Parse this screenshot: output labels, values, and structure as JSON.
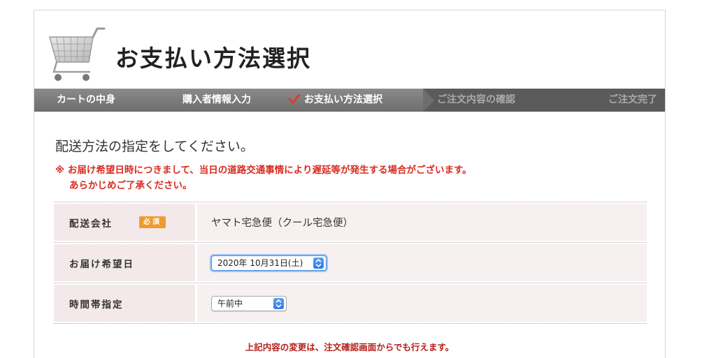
{
  "header": {
    "title": "お支払い方法選択",
    "cart_icon": "shopping-cart-icon"
  },
  "steps": [
    {
      "label": "カートの中身",
      "state": "done"
    },
    {
      "label": "購入者情報入力",
      "state": "done"
    },
    {
      "label": "お支払い方法選択",
      "state": "current",
      "icon": "check-icon"
    },
    {
      "label": "ご注文内容の確認",
      "state": "upcoming"
    },
    {
      "label": "ご注文完了",
      "state": "upcoming"
    }
  ],
  "main": {
    "heading": "配送方法の指定をしてください。",
    "notice_line1": "※ お届け希望日時につきまして、当日の道路交通事情により遅延等が発生する場合がございます。",
    "notice_line2": "あらかじめご了承ください。",
    "rows": [
      {
        "label": "配送会社",
        "badge": "必須",
        "value": "ヤマト宅急便（クール宅急便）"
      },
      {
        "label": "お届け希望日",
        "select_value": "2020年 10月31日(土)"
      },
      {
        "label": "時間帯指定",
        "select_value": "午前中"
      }
    ],
    "footnote": "上記内容の変更は、注文確認画面からでも行えます。"
  },
  "colors": {
    "accent_red": "#d92b20",
    "badge_orange": "#f09a2e",
    "label_bg": "#f4e9ea",
    "step_bar": "#777777"
  }
}
